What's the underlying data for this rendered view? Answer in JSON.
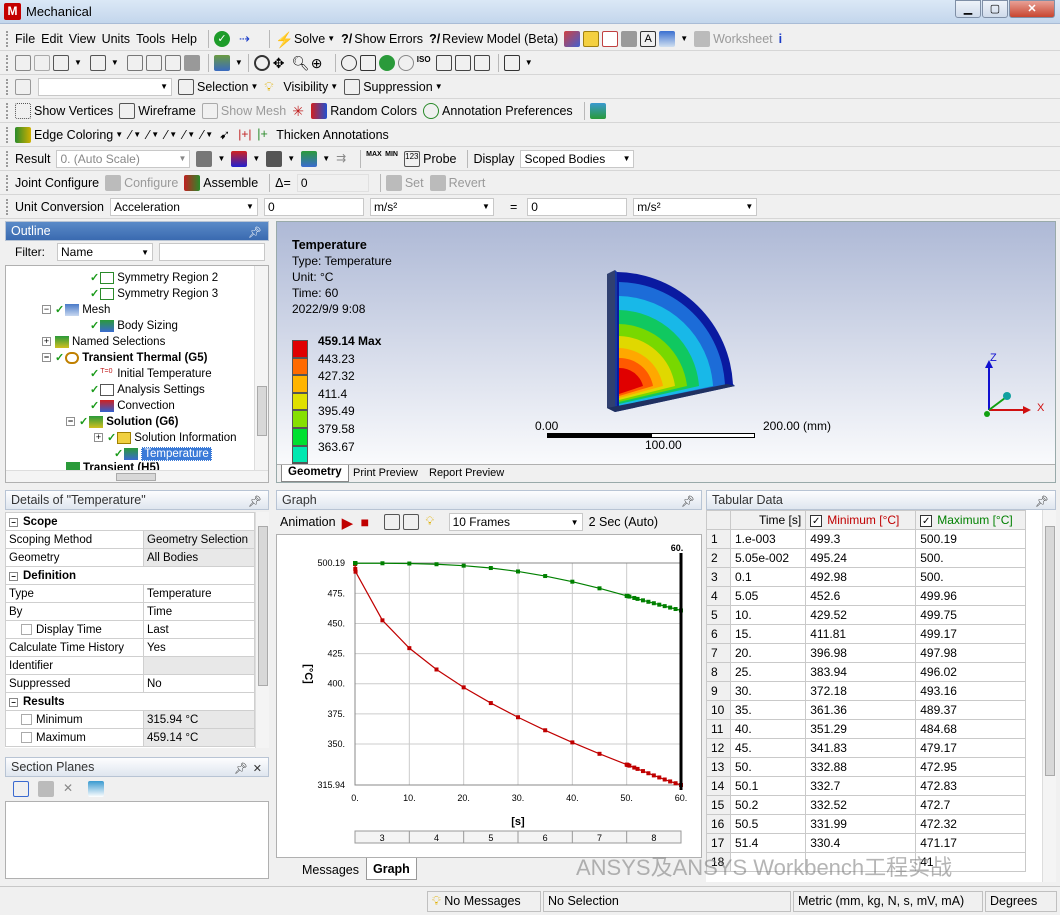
{
  "app": {
    "title": "Mechanical"
  },
  "menu": {
    "items": [
      "File",
      "Edit",
      "View",
      "Units",
      "Tools",
      "Help"
    ],
    "solve": "Solve",
    "show_errors": "Show Errors",
    "review_model": "Review Model (Beta)",
    "worksheet": "Worksheet"
  },
  "toolbar3": {
    "selection": "Selection",
    "visibility": "Visibility",
    "suppression": "Suppression"
  },
  "toolbar4": {
    "show_vertices": "Show Vertices",
    "wireframe": "Wireframe",
    "show_mesh": "Show Mesh",
    "random_colors": "Random Colors",
    "annotation_prefs": "Annotation Preferences"
  },
  "toolbar5": {
    "edge_coloring": "Edge Coloring",
    "thicken": "Thicken Annotations"
  },
  "toolbar6": {
    "result_label": "Result",
    "scale": "0. (Auto Scale)",
    "probe": "Probe",
    "display_label": "Display",
    "display_value": "Scoped Bodies"
  },
  "toolbar7": {
    "joint_configure": "Joint Configure",
    "configure": "Configure",
    "assemble": "Assemble",
    "delta": "Δ=",
    "delta_value": "0",
    "set": "Set",
    "revert": "Revert"
  },
  "toolbar8": {
    "label": "Unit Conversion",
    "quantity": "Acceleration",
    "value1": "0",
    "unit1": "m/s²",
    "eq": "=",
    "value2": "0",
    "unit2": "m/s²"
  },
  "outline": {
    "title": "Outline",
    "filter_label": "Filter:",
    "filter_value": "Name",
    "nodes": [
      {
        "label": "Symmetry Region 2",
        "bold": false
      },
      {
        "label": "Symmetry Region 3",
        "bold": false
      },
      {
        "label": "Mesh",
        "bold": false
      },
      {
        "label": "Body Sizing",
        "bold": false
      },
      {
        "label": "Named Selections",
        "bold": false
      },
      {
        "label": "Transient Thermal (G5)",
        "bold": true
      },
      {
        "label": "Initial Temperature",
        "bold": false
      },
      {
        "label": "Analysis Settings",
        "bold": false
      },
      {
        "label": "Convection",
        "bold": false
      },
      {
        "label": "Solution (G6)",
        "bold": true
      },
      {
        "label": "Solution Information",
        "bold": false
      },
      {
        "label": "Temperature",
        "bold": false
      },
      {
        "label": "Transient (H5)",
        "bold": true
      }
    ]
  },
  "viewport": {
    "title": "Temperature",
    "type": "Type: Temperature",
    "unit": "Unit: °C",
    "time": "Time: 60",
    "date": "2022/9/9 9:08",
    "legend": [
      {
        "label": "459.14 Max",
        "color": "#e00000",
        "bold": true
      },
      {
        "label": "443.23",
        "color": "#ff6a00"
      },
      {
        "label": "427.32",
        "color": "#ffb400"
      },
      {
        "label": "411.4",
        "color": "#e0e000"
      },
      {
        "label": "395.49",
        "color": "#86e000"
      },
      {
        "label": "379.58",
        "color": "#00e030"
      },
      {
        "label": "363.67",
        "color": "#00e8b0"
      },
      {
        "label": "",
        "color": "#00d8f0"
      }
    ],
    "scale_start": "0.00",
    "scale_mid": "100.00",
    "scale_end": "200.00 (mm)",
    "axis_z": "Z",
    "axis_x": "X",
    "tabs": [
      "Geometry",
      "Print Preview",
      "Report Preview"
    ]
  },
  "details": {
    "title": "Details of \"Temperature\"",
    "rows": [
      {
        "group": "Scope"
      },
      {
        "k": "Scoping Method",
        "v": "Geometry Selection"
      },
      {
        "k": "Geometry",
        "v": "All Bodies"
      },
      {
        "group": "Definition"
      },
      {
        "k": "Type",
        "v": "Temperature"
      },
      {
        "k": "By",
        "v": "Time"
      },
      {
        "k": "Display Time",
        "v": "Last",
        "cb": true
      },
      {
        "k": "Calculate Time History",
        "v": "Yes"
      },
      {
        "k": "Identifier",
        "v": ""
      },
      {
        "k": "Suppressed",
        "v": "No"
      },
      {
        "group": "Results"
      },
      {
        "k": "Minimum",
        "v": "315.94 °C",
        "cb": true
      },
      {
        "k": "Maximum",
        "v": "459.14 °C",
        "cb": true
      }
    ]
  },
  "section_planes": {
    "title": "Section Planes"
  },
  "graph": {
    "title": "Graph",
    "animation": "Animation",
    "frames": "10 Frames",
    "duration": "2 Sec (Auto)",
    "ylabel": "[°C]",
    "xlabel": "[s]",
    "cursor_label": "60.",
    "steps": [
      "3",
      "4",
      "5",
      "6",
      "7",
      "8"
    ],
    "tabs": [
      "Messages",
      "Graph"
    ]
  },
  "tabular": {
    "title": "Tabular Data",
    "headers": [
      "Time [s]",
      "Minimum [°C]",
      "Maximum [°C]"
    ],
    "rows": [
      [
        "1",
        "1.e-003",
        "499.3",
        "500.19"
      ],
      [
        "2",
        "5.05e-002",
        "495.24",
        "500."
      ],
      [
        "3",
        "0.1",
        "492.98",
        "500."
      ],
      [
        "4",
        "5.05",
        "452.6",
        "499.96"
      ],
      [
        "5",
        "10.",
        "429.52",
        "499.75"
      ],
      [
        "6",
        "15.",
        "411.81",
        "499.17"
      ],
      [
        "7",
        "20.",
        "396.98",
        "497.98"
      ],
      [
        "8",
        "25.",
        "383.94",
        "496.02"
      ],
      [
        "9",
        "30.",
        "372.18",
        "493.16"
      ],
      [
        "10",
        "35.",
        "361.36",
        "489.37"
      ],
      [
        "11",
        "40.",
        "351.29",
        "484.68"
      ],
      [
        "12",
        "45.",
        "341.83",
        "479.17"
      ],
      [
        "13",
        "50.",
        "332.88",
        "472.95"
      ],
      [
        "14",
        "50.1",
        "332.7",
        "472.83"
      ],
      [
        "15",
        "50.2",
        "332.52",
        "472.7"
      ],
      [
        "16",
        "50.5",
        "331.99",
        "472.32"
      ],
      [
        "17",
        "51.4",
        "330.4",
        "471.17"
      ],
      [
        "18",
        "",
        "",
        "41"
      ]
    ]
  },
  "chart_data": {
    "type": "line",
    "x": [
      0.001,
      0.0505,
      0.1,
      5.05,
      10,
      15,
      20,
      25,
      30,
      35,
      40,
      45,
      50,
      50.1,
      50.2,
      50.5,
      51.4,
      52,
      53,
      54,
      55,
      56,
      57,
      58,
      59,
      60
    ],
    "series": [
      {
        "name": "Minimum [°C]",
        "color": "#c00000",
        "values": [
          499.3,
          495.24,
          492.98,
          452.6,
          429.52,
          411.81,
          396.98,
          383.94,
          372.18,
          361.36,
          351.29,
          341.83,
          332.88,
          332.7,
          332.52,
          331.99,
          330.4,
          329.3,
          327.5,
          325.7,
          323.9,
          322.2,
          320.5,
          318.9,
          317.4,
          315.94
        ]
      },
      {
        "name": "Maximum [°C]",
        "color": "#008000",
        "values": [
          500.19,
          500,
          500,
          499.96,
          499.75,
          499.17,
          497.98,
          496.02,
          493.16,
          489.37,
          484.68,
          479.17,
          472.95,
          472.83,
          472.7,
          472.32,
          471.17,
          470.4,
          469.2,
          468,
          466.8,
          465.6,
          464.4,
          463.2,
          462,
          460.8
        ]
      }
    ],
    "xticks": [
      "0.",
      "10.",
      "20.",
      "30.",
      "40.",
      "50.",
      "60."
    ],
    "yticks": [
      "315.94",
      "350.",
      "375.",
      "400.",
      "425.",
      "450.",
      "475.",
      "500.19"
    ],
    "xlim": [
      0,
      60
    ],
    "ylim": [
      315.94,
      500.19
    ],
    "xlabel": "[s]",
    "ylabel": "[°C]"
  },
  "status": {
    "messages": "No Messages",
    "selection": "No Selection",
    "units": "Metric (mm, kg, N, s, mV, mA)",
    "angle": "Degrees"
  },
  "watermark": "ANSYS及ANSYS Workbench工程实战"
}
